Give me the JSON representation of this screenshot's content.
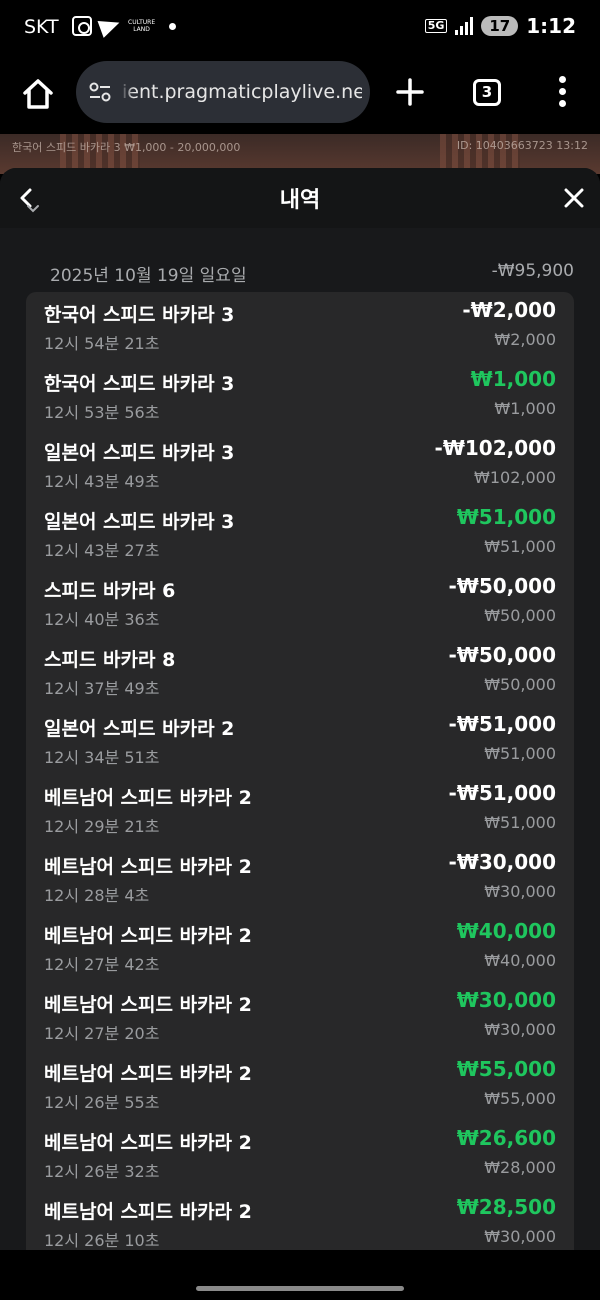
{
  "status_bar": {
    "carrier": "SKT",
    "logo_text": "CULTURE\nLAND",
    "network": "5G",
    "battery": "17",
    "time": "1:12"
  },
  "browser": {
    "url": "ient.pragmaticplaylive.net",
    "tab_count": "3"
  },
  "game_strip": {
    "left_text": "한국어 스피드 바카라 3  ₩1,000 - 20,000,000",
    "right_text": "ID: 10403663723 13:12"
  },
  "sheet": {
    "title": "내역"
  },
  "day": {
    "date": "2025년 10월 19일 일요일",
    "total": "-₩95,900"
  },
  "entries": [
    {
      "name": "한국어 스피드 바카라 3",
      "time": "12시 54분 21초",
      "amount": "-₩2,000",
      "bet": "₩2,000",
      "win": false
    },
    {
      "name": "한국어 스피드 바카라 3",
      "time": "12시 53분 56초",
      "amount": "₩1,000",
      "bet": "₩1,000",
      "win": true
    },
    {
      "name": "일본어 스피드 바카라 3",
      "time": "12시 43분 49초",
      "amount": "-₩102,000",
      "bet": "₩102,000",
      "win": false
    },
    {
      "name": "일본어 스피드 바카라 3",
      "time": "12시 43분 27초",
      "amount": "₩51,000",
      "bet": "₩51,000",
      "win": true
    },
    {
      "name": "스피드 바카라 6",
      "time": "12시 40분 36초",
      "amount": "-₩50,000",
      "bet": "₩50,000",
      "win": false
    },
    {
      "name": "스피드 바카라 8",
      "time": "12시 37분 49초",
      "amount": "-₩50,000",
      "bet": "₩50,000",
      "win": false
    },
    {
      "name": "일본어 스피드 바카라 2",
      "time": "12시 34분 51초",
      "amount": "-₩51,000",
      "bet": "₩51,000",
      "win": false
    },
    {
      "name": "베트남어 스피드 바카라 2",
      "time": "12시 29분 21초",
      "amount": "-₩51,000",
      "bet": "₩51,000",
      "win": false
    },
    {
      "name": "베트남어 스피드 바카라 2",
      "time": "12시 28분 4초",
      "amount": "-₩30,000",
      "bet": "₩30,000",
      "win": false
    },
    {
      "name": "베트남어 스피드 바카라 2",
      "time": "12시 27분 42초",
      "amount": "₩40,000",
      "bet": "₩40,000",
      "win": true
    },
    {
      "name": "베트남어 스피드 바카라 2",
      "time": "12시 27분 20초",
      "amount": "₩30,000",
      "bet": "₩30,000",
      "win": true
    },
    {
      "name": "베트남어 스피드 바카라 2",
      "time": "12시 26분 55초",
      "amount": "₩55,000",
      "bet": "₩55,000",
      "win": true
    },
    {
      "name": "베트남어 스피드 바카라 2",
      "time": "12시 26분 32초",
      "amount": "₩26,600",
      "bet": "₩28,000",
      "win": true
    },
    {
      "name": "베트남어 스피드 바카라 2",
      "time": "12시 26분 10초",
      "amount": "₩28,500",
      "bet": "₩30,000",
      "win": true
    }
  ],
  "colors": {
    "win": "#1fc65e",
    "loss": "#ffffff",
    "background": "#18191b",
    "card": "#282829"
  }
}
